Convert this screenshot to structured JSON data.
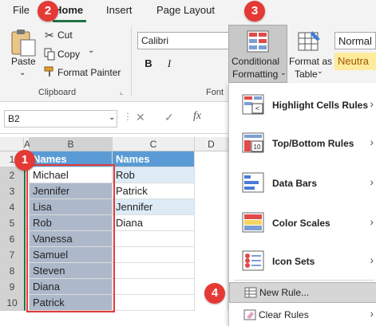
{
  "tabs": [
    "File",
    "Home",
    "Insert",
    "Page Layout"
  ],
  "badges": [
    "1",
    "2",
    "3",
    "4"
  ],
  "clipboard": {
    "paste": "Paste",
    "cut": "Cut",
    "copy": "Copy",
    "format_painter": "Format Painter",
    "group_label": "Clipboard"
  },
  "font": {
    "name": "Calibri",
    "bold": "B",
    "italic": "I",
    "group_label": "Font"
  },
  "styles": {
    "conditional_formatting_line1": "Conditional",
    "conditional_formatting_line2": "Formatting",
    "format_as_table_line1": "Format as",
    "format_as_table_line2": "Table",
    "normal": "Normal",
    "neutral": "Neutra"
  },
  "formula_bar": {
    "name_box": "B2",
    "fx": "fx"
  },
  "grid": {
    "columns": [
      "A",
      "B",
      "C",
      "D"
    ],
    "rows": [
      "1",
      "2",
      "3",
      "4",
      "5",
      "6",
      "7",
      "8",
      "9",
      "10"
    ],
    "col_b": [
      "Names",
      "Michael",
      "Jennifer",
      "Lisa",
      "Rob",
      "Vanessa",
      "Samuel",
      "Steven",
      "Diana",
      "Patrick"
    ],
    "col_c": [
      "Names",
      "Rob",
      "Patrick",
      "Jennifer",
      "Diana"
    ]
  },
  "menu": {
    "items": [
      {
        "label": "Highlight Cells Rules",
        "icon": "highlight-cells-icon"
      },
      {
        "label": "Top/Bottom Rules",
        "icon": "top-bottom-icon"
      },
      {
        "label": "Data Bars",
        "icon": "data-bars-icon"
      },
      {
        "label": "Color Scales",
        "icon": "color-scales-icon"
      },
      {
        "label": "Icon Sets",
        "icon": "icon-sets-icon"
      }
    ],
    "new_rule": "New Rule...",
    "clear_rules": "Clear Rules"
  },
  "colors": {
    "header_blue": "#5b9bd5",
    "light_blue": "#ddebf7",
    "selection_gray": "#adb9ca",
    "badge_red": "#e53935",
    "accent_green": "#217346"
  }
}
